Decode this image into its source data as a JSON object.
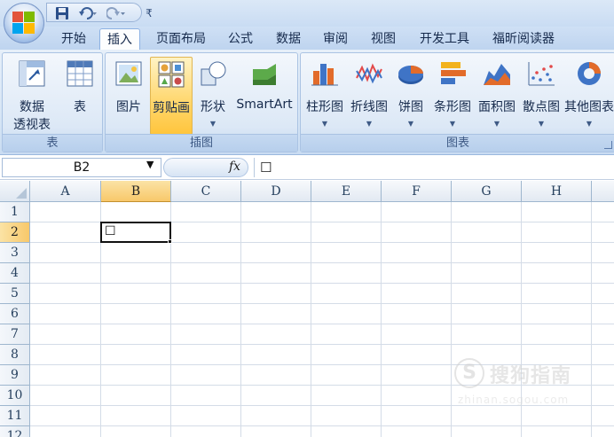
{
  "window": {
    "quick_access": {
      "save_icon": "save-icon",
      "undo_icon": "undo-icon",
      "redo_icon": "redo-icon",
      "customize_glyph": "₹"
    }
  },
  "tabs": [
    {
      "label": "开始",
      "active": false
    },
    {
      "label": "插入",
      "active": true
    },
    {
      "label": "页面布局",
      "active": false
    },
    {
      "label": "公式",
      "active": false
    },
    {
      "label": "数据",
      "active": false
    },
    {
      "label": "审阅",
      "active": false
    },
    {
      "label": "视图",
      "active": false
    },
    {
      "label": "开发工具",
      "active": false
    },
    {
      "label": "福昕阅读器",
      "active": false
    }
  ],
  "ribbon": {
    "groups": {
      "tables": {
        "label": "表",
        "pivot_label_1": "数据",
        "pivot_label_2": "透视表",
        "table_label": "表"
      },
      "illustrations": {
        "label": "插图",
        "picture_label": "图片",
        "clipart_label": "剪贴画",
        "shapes_label": "形状",
        "smartart_label": "SmartArt"
      },
      "charts": {
        "label": "图表",
        "column_label": "柱形图",
        "line_label": "折线图",
        "pie_label": "饼图",
        "bar_label": "条形图",
        "area_label": "面积图",
        "scatter_label": "散点图",
        "other_label": "其他图表"
      }
    }
  },
  "formula_bar": {
    "name_box": "B2",
    "fx_label": "fx",
    "content": "☐"
  },
  "sheet": {
    "columns": [
      "A",
      "B",
      "C",
      "D",
      "E",
      "F",
      "G",
      "H"
    ],
    "rows": [
      "1",
      "2",
      "3",
      "4",
      "5",
      "6",
      "7",
      "8",
      "9",
      "10",
      "11",
      "12"
    ],
    "selected_column": "B",
    "selected_row": "2",
    "cells": {
      "B2": "☐"
    }
  },
  "watermark": {
    "logo_glyph": "S",
    "text": "搜狗指南",
    "url": "zhinan.sogou.com"
  }
}
